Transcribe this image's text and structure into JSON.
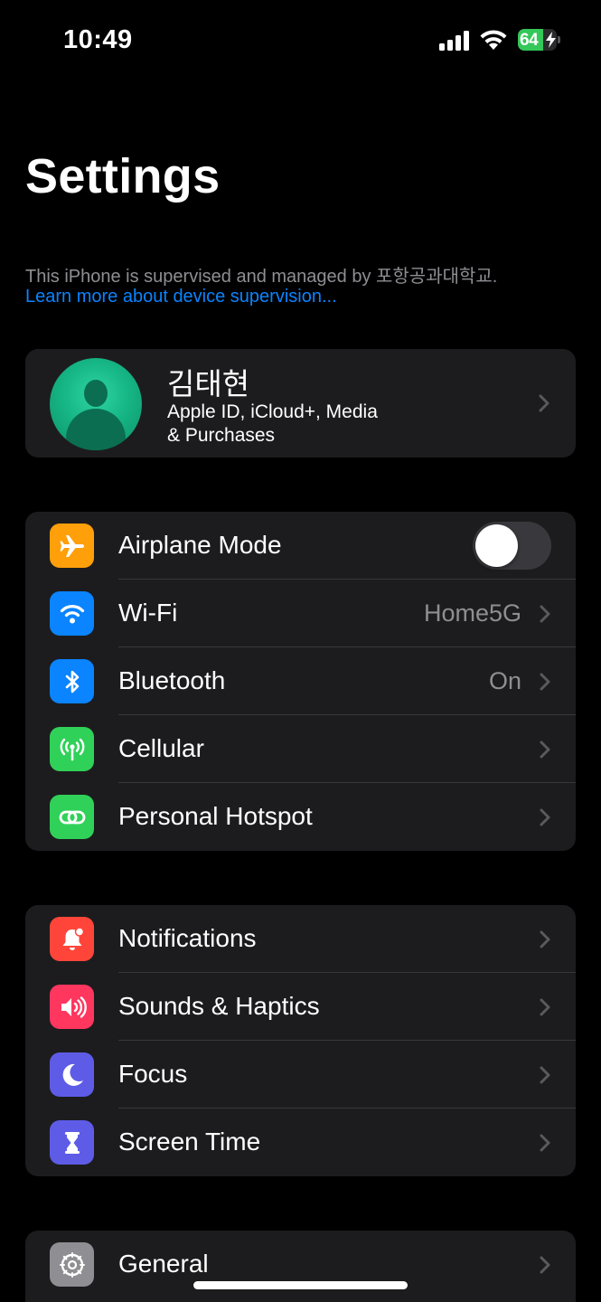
{
  "status_bar": {
    "time": "10:49",
    "battery_level": "64",
    "battery_percent": 64,
    "charging": true
  },
  "title": "Settings",
  "supervision": {
    "text": "This iPhone is supervised and managed by 포항공과대학교.",
    "link": "Learn more about device supervision..."
  },
  "profile": {
    "name": "김태현",
    "subtitle_line1": "Apple ID, iCloud+, Media",
    "subtitle_line2": "& Purchases"
  },
  "connectivity": {
    "airplane": {
      "label": "Airplane Mode",
      "enabled": false,
      "icon": "airplane-icon",
      "color": "#ff9f0a"
    },
    "wifi": {
      "label": "Wi-Fi",
      "value": "Home5G",
      "icon": "wifi-icon",
      "color": "#0a84ff"
    },
    "bluetooth": {
      "label": "Bluetooth",
      "value": "On",
      "icon": "bluetooth-icon",
      "color": "#0a84ff"
    },
    "cellular": {
      "label": "Cellular",
      "icon": "antenna-icon",
      "color": "#30d158"
    },
    "hotspot": {
      "label": "Personal Hotspot",
      "icon": "link-icon",
      "color": "#30d158"
    }
  },
  "attention": {
    "notifications": {
      "label": "Notifications",
      "icon": "bell-icon",
      "color": "#ff453a"
    },
    "sounds": {
      "label": "Sounds & Haptics",
      "icon": "speaker-icon",
      "color": "#ff375f"
    },
    "focus": {
      "label": "Focus",
      "icon": "moon-icon",
      "color": "#5e5ce6"
    },
    "screen_time": {
      "label": "Screen Time",
      "icon": "hourglass-icon",
      "color": "#5e5ce6"
    }
  },
  "system": {
    "general": {
      "label": "General",
      "icon": "gear-icon",
      "color": "#8e8e93"
    }
  }
}
